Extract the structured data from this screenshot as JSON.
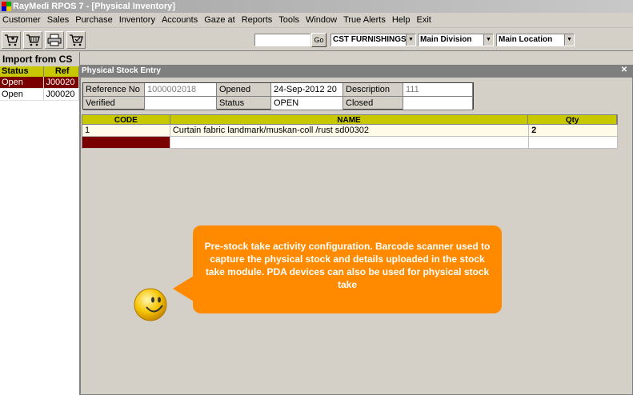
{
  "window": {
    "title": "RayMedi RPOS 7 - [Physical Inventory]"
  },
  "menu": [
    "Customer",
    "Sales",
    "Purchase",
    "Inventory",
    "Accounts",
    "Gaze at",
    "Reports",
    "Tools",
    "Window",
    "True Alerts",
    "Help",
    "Exit"
  ],
  "toolbar": {
    "buttons": [
      "cart-add-icon",
      "cart-icon",
      "printer-icon",
      "cart-check-icon"
    ],
    "search_value": "",
    "go_label": "Go",
    "company": "CST FURNISHINGS",
    "division": "Main Division",
    "location": "Main Location"
  },
  "left_panel": {
    "title": "Import from CS",
    "headers": [
      "Status",
      "Ref"
    ],
    "rows": [
      {
        "status": "Open",
        "ref": "J00020"
      },
      {
        "status": "Open",
        "ref": "J00020"
      }
    ]
  },
  "stock_entry": {
    "title": "Physical Stock Entry",
    "fields": {
      "reference_no_label": "Reference No",
      "reference_no_value": "1000002018",
      "opened_label": "Opened",
      "opened_value": "24-Sep-2012 20",
      "description_label": "Description",
      "description_value": "111",
      "verified_label": "Verified",
      "verified_value": "",
      "status_label": "Status",
      "status_value": "OPEN",
      "closed_label": "Closed",
      "closed_value": ""
    },
    "grid": {
      "headers": [
        "CODE",
        "NAME",
        "Qty"
      ],
      "rows": [
        {
          "code": "1",
          "name": "Curtain fabric  landmark/muskan-coll  /rust   sd00302",
          "qty": "2"
        }
      ]
    }
  },
  "callout": {
    "text": "Pre-stock take activity configuration. Barcode scanner used to capture the physical stock and details uploaded in the stock take module. PDA devices can also be used for physical stock take"
  },
  "colors": {
    "header_yellow": "#c8c800",
    "selected_row": "#7a0000",
    "callout_orange": "#ff8a00"
  }
}
